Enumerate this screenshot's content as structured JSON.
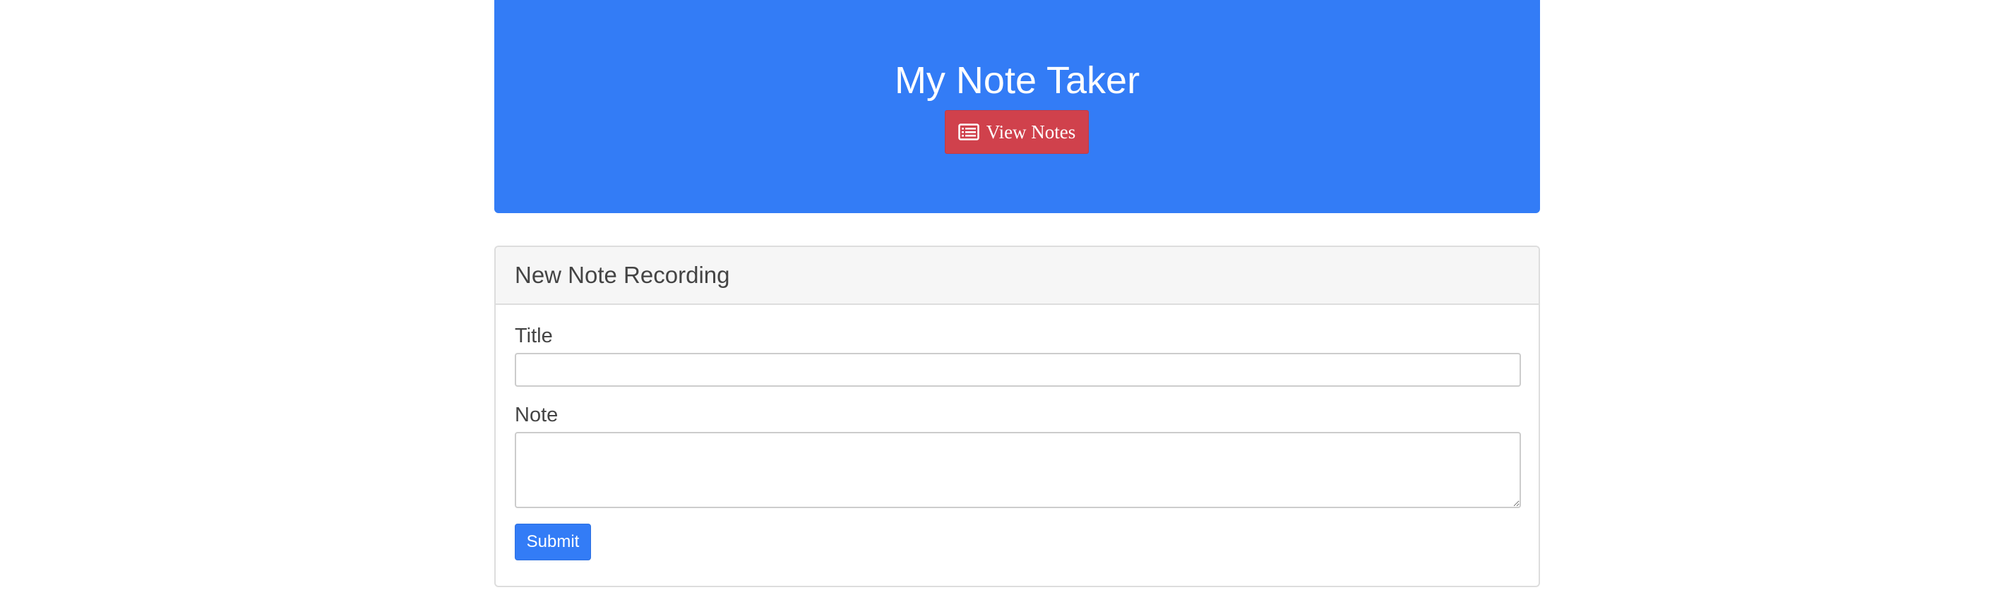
{
  "header": {
    "title": "My Note Taker",
    "view_button": {
      "label": "View Notes",
      "icon": "list-alt-icon"
    }
  },
  "form": {
    "heading": "New Note Recording",
    "title_label": "Title",
    "title_value": "",
    "note_label": "Note",
    "note_value": "",
    "submit_label": "Submit"
  },
  "colors": {
    "primary": "#337cf6",
    "danger": "#d0414c",
    "panel_heading_bg": "#f6f6f6"
  }
}
